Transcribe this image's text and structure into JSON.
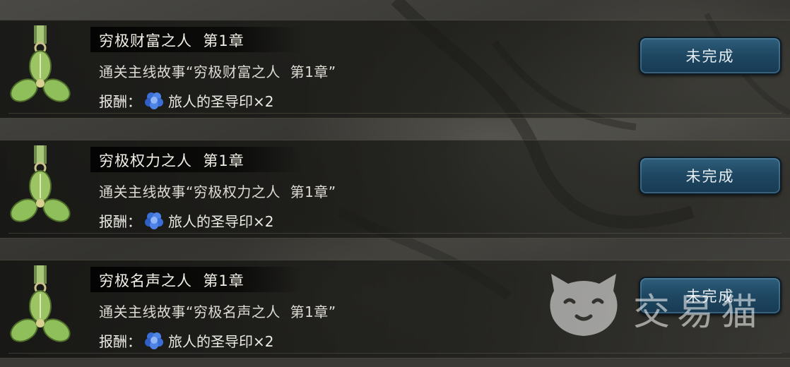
{
  "main": {
    "rows": [
      {
        "title": "穷极财富之人  第1章",
        "description": "通关主线故事“穷极财富之人  第1章”",
        "reward_label": "报酬：",
        "reward_item": "旅人的圣导印×2",
        "status_label": "未完成",
        "medal_icon": "medal-icon",
        "reward_icon": "blue-gem-icon"
      },
      {
        "title": "穷极权力之人  第1章",
        "description": "通关主线故事“穷极权力之人  第1章”",
        "reward_label": "报酬：",
        "reward_item": "旅人的圣导印×2",
        "status_label": "未完成",
        "medal_icon": "medal-icon",
        "reward_icon": "blue-gem-icon"
      },
      {
        "title": "穷极名声之人  第1章",
        "description": "通关主线故事“穷极名声之人  第1章”",
        "reward_label": "报酬：",
        "reward_item": "旅人的圣导印×2",
        "status_label": "未完成",
        "medal_icon": "medal-icon",
        "reward_icon": "blue-gem-icon"
      }
    ]
  },
  "watermark": {
    "text": "交易猫",
    "icon": "cat-logo-icon"
  },
  "colors": {
    "button_fill": "#1f4863",
    "medal_green": "#9cc464",
    "gem_blue": "#3a6fd8"
  }
}
